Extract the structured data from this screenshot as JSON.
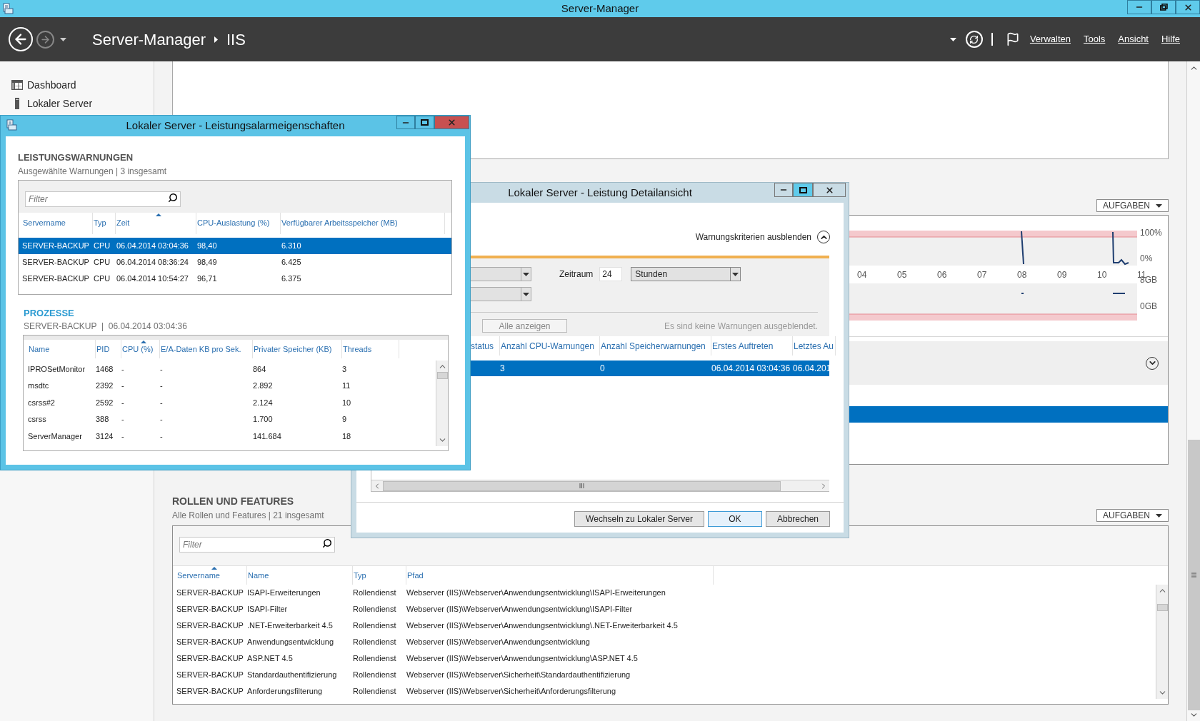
{
  "window": {
    "title": "Server-Manager"
  },
  "header": {
    "breadcrumb": [
      "Server-Manager",
      "IIS"
    ],
    "menu": [
      "Verwalten",
      "Tools",
      "Ansicht",
      "Hilfe"
    ]
  },
  "sidebar": {
    "items": [
      {
        "kind": "dashboard",
        "label": "Dashboard",
        "selected": false
      },
      {
        "kind": "server",
        "label": "Lokaler Server",
        "selected": false
      }
    ]
  },
  "performance": {
    "tasks_button": "AUFGABEN",
    "x_labels": [
      "04",
      "05",
      "06",
      "07",
      "08",
      "09",
      "10",
      "11"
    ],
    "cpu_labels": [
      "100%",
      "0%"
    ],
    "memory_labels": [
      "8GB",
      "0GB"
    ]
  },
  "roles": {
    "title": "ROLLEN UND FEATURES",
    "subtitle": "Alle Rollen und Features | 21 insgesamt",
    "tasks_button": "AUFGABEN",
    "filter": {
      "placeholder": "Filter"
    },
    "columns": [
      {
        "label": "Servername",
        "sorted": true
      },
      {
        "label": "Name",
        "sorted": false
      },
      {
        "label": "Typ",
        "sorted": false
      },
      {
        "label": "Pfad",
        "sorted": false
      }
    ],
    "rows": [
      [
        "SERVER-BACKUP",
        "ISAPI-Erweiterungen",
        "Rollendienst",
        "Webserver (IIS)\\Webserver\\Anwendungsentwicklung\\ISAPI-Erweiterungen"
      ],
      [
        "SERVER-BACKUP",
        "ISAPI-Filter",
        "Rollendienst",
        "Webserver (IIS)\\Webserver\\Anwendungsentwicklung\\ISAPI-Filter"
      ],
      [
        "SERVER-BACKUP",
        ".NET-Erweiterbarkeit 4.5",
        "Rollendienst",
        "Webserver (IIS)\\Webserver\\Anwendungsentwicklung\\.NET-Erweiterbarkeit 4.5"
      ],
      [
        "SERVER-BACKUP",
        "Anwendungsentwicklung",
        "Rollendienst",
        "Webserver (IIS)\\Webserver\\Anwendungsentwicklung"
      ],
      [
        "SERVER-BACKUP",
        "ASP.NET 4.5",
        "Rollendienst",
        "Webserver (IIS)\\Webserver\\Anwendungsentwicklung\\ASP.NET 4.5"
      ],
      [
        "SERVER-BACKUP",
        "Standardauthentifizierung",
        "Rollendienst",
        "Webserver (IIS)\\Webserver\\Sicherheit\\Standardauthentifizierung"
      ],
      [
        "SERVER-BACKUP",
        "Anforderungsfilterung",
        "Rollendienst",
        "Webserver (IIS)\\Webserver\\Sicherheit\\Anforderungsfilterung"
      ]
    ]
  },
  "detail_dialog": {
    "title": "Lokaler Server - Leistung Detailansicht",
    "toggle": "Warnungskriterien ausblenden",
    "period_label": "Zeitraum",
    "period_value": "24",
    "period_unit": "Stunden",
    "show_all": "Alle anzeigen",
    "hidden_note": "Es sind keine Warnungen ausgeblendet.",
    "columns": [
      "status",
      "Anzahl CPU-Warnungen",
      "Anzahl Speicherwarnungen",
      "Erstes Auftreten",
      "Letztes Au"
    ],
    "rows": [
      {
        "cells": [
          "",
          "3",
          "0",
          "06.04.2014 03:04:36",
          "06.04.201"
        ],
        "selected": true
      }
    ],
    "buttons": [
      {
        "label": "Wechseln zu Lokaler Server",
        "default": false
      },
      {
        "label": "OK",
        "default": true
      },
      {
        "label": "Abbrechen",
        "default": false
      }
    ]
  },
  "alert_dialog": {
    "title": "Lokaler Server - Leistungsalarmeigenschaften",
    "warnings": {
      "title": "LEISTUNGSWARNUNGEN",
      "subtitle": "Ausgewählte Warnungen | 3 insgesamt",
      "filter": {
        "placeholder": "Filter"
      },
      "columns": [
        {
          "label": "Servername",
          "sorted": false
        },
        {
          "label": "Typ",
          "sorted": false
        },
        {
          "label": "Zeit",
          "sorted": true
        },
        {
          "label": "CPU-Auslastung (%)",
          "sorted": false
        },
        {
          "label": "Verfügbarer Arbeitsspeicher (MB)",
          "sorted": false
        }
      ],
      "rows": [
        {
          "cells": [
            "SERVER-BACKUP",
            "CPU",
            "06.04.2014 03:04:36",
            "98,40",
            "6.310"
          ],
          "selected": true
        },
        {
          "cells": [
            "SERVER-BACKUP",
            "CPU",
            "06.04.2014 08:36:24",
            "98,49",
            "6.425"
          ],
          "selected": false
        },
        {
          "cells": [
            "SERVER-BACKUP",
            "CPU",
            "06.04.2014 10:54:27",
            "96,71",
            "6.375"
          ],
          "selected": false
        }
      ]
    },
    "processes": {
      "title": "PROZESSE",
      "subtitle": "SERVER-BACKUP  |  06.04.2014 03:04:36",
      "columns": [
        {
          "label": "Name",
          "sorted": false
        },
        {
          "label": "PID",
          "sorted": false
        },
        {
          "label": "CPU (%)",
          "sorted": true
        },
        {
          "label": "E/A-Daten KB pro Sek.",
          "sorted": false
        },
        {
          "label": "Privater Speicher (KB)",
          "sorted": false
        },
        {
          "label": "Threads",
          "sorted": false
        }
      ],
      "rows": [
        [
          "IPROSetMonitor",
          "1468",
          "-",
          "-",
          "864",
          "3"
        ],
        [
          "msdtc",
          "2392",
          "-",
          "-",
          "2.892",
          "11"
        ],
        [
          "csrss#2",
          "2592",
          "-",
          "-",
          "2.124",
          "10"
        ],
        [
          "csrss",
          "388",
          "-",
          "-",
          "1.700",
          "9"
        ],
        [
          "ServerManager",
          "3124",
          "-",
          "-",
          "141.684",
          "18"
        ]
      ]
    }
  }
}
